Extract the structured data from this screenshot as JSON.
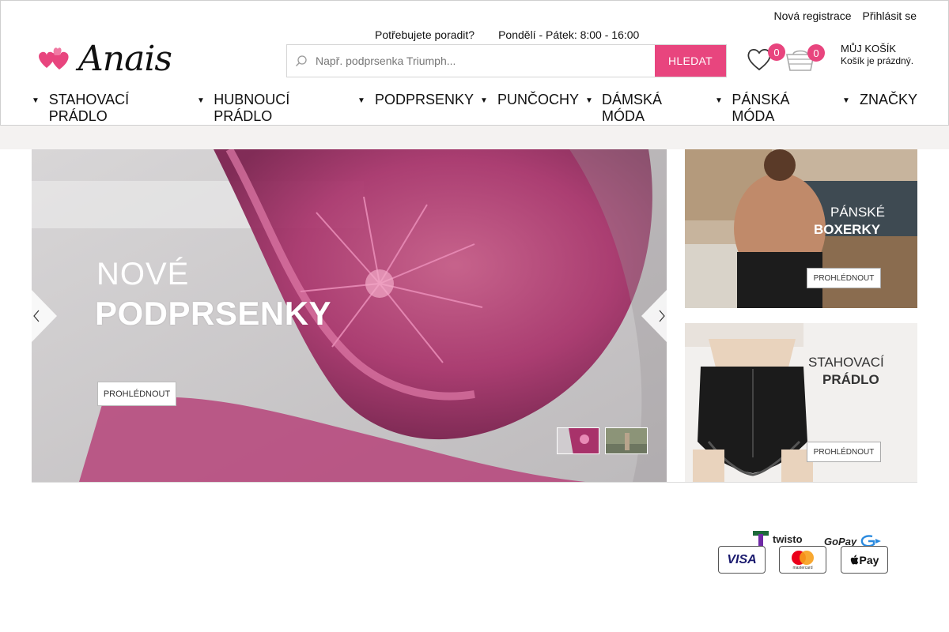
{
  "header": {
    "register": "Nová registrace",
    "login": "Přihlásit se",
    "logo_text": "Anais",
    "help_question": "Potřebujete poradit?",
    "help_hours": "Pondělí - Pátek: 8:00 - 16:00",
    "search_placeholder": "Např. podprsenka Triumph...",
    "search_button": "HLEDAT",
    "wishlist_count": "0",
    "cart_count": "0",
    "cart_title": "MŮJ KOŠÍK",
    "cart_status": "Košík je prázdný."
  },
  "nav": {
    "items": [
      {
        "label": "STAHOVACÍ PRÁDLO"
      },
      {
        "label": "HUBNOUCÍ PRÁDLO"
      },
      {
        "label": "PODPRSENKY"
      },
      {
        "label": "PUNČOCHY"
      },
      {
        "label": "DÁMSKÁ MÓDA"
      },
      {
        "label": "PÁNSKÁ MÓDA"
      },
      {
        "label": "ZNAČKY"
      }
    ]
  },
  "hero": {
    "line1": "NOVÉ",
    "line2": "PODPRSENKY",
    "button": "PROHLÉDNOUT"
  },
  "banners": [
    {
      "line1": "PÁNSKÉ",
      "line2": "BOXERKY",
      "button": "PROHLÉDNOUT"
    },
    {
      "line1": "STAHOVACÍ",
      "line2": "PRÁDLO",
      "button": "PROHLÉDNOUT"
    }
  ],
  "payments": {
    "twisto": "twisto",
    "gopay": "GoPay",
    "visa": "VISA",
    "mastercard": "mastercard",
    "applepay": "Pay"
  },
  "colors": {
    "accent": "#e8457e"
  }
}
